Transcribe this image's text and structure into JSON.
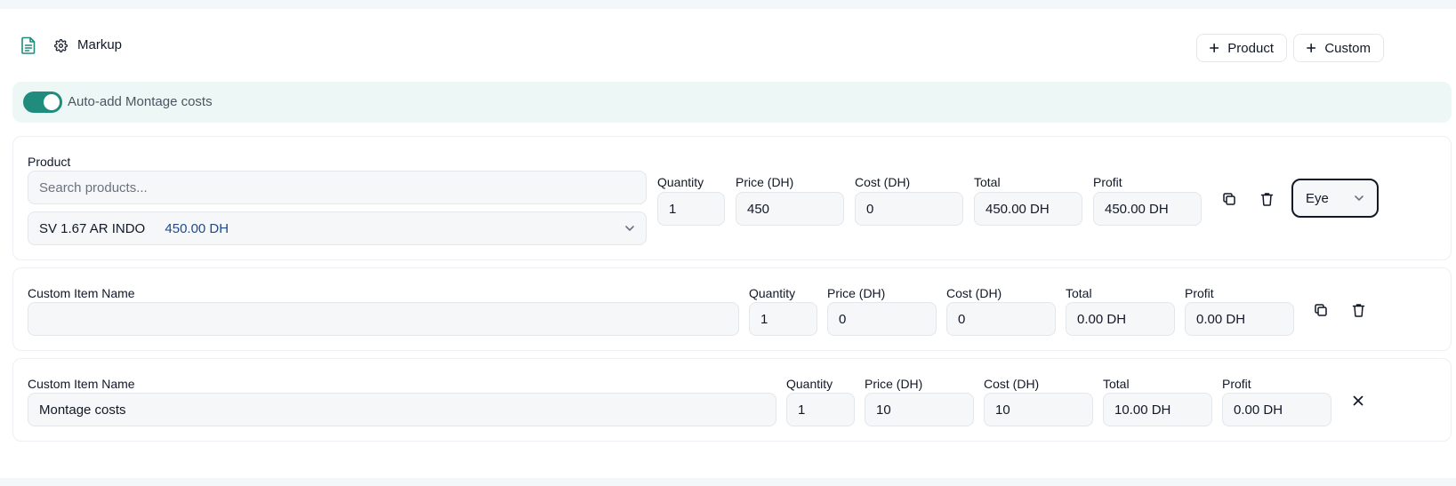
{
  "header": {
    "title": "Markup",
    "add_product_label": "Product",
    "add_custom_label": "Custom"
  },
  "toggle": {
    "label": "Auto-add Montage costs",
    "enabled": true
  },
  "colors": {
    "accent": "#1f8c7d",
    "toggle_bg": "#edf7f5",
    "price_link": "#1e4a8a"
  },
  "product_row": {
    "product_label": "Product",
    "search_placeholder": "Search products...",
    "selected_name": "SV 1.67 AR INDO",
    "selected_price": "450.00 DH",
    "quantity_label": "Quantity",
    "quantity": "1",
    "price_label": "Price (DH)",
    "price": "450",
    "cost_label": "Cost (DH)",
    "cost": "0",
    "total_label": "Total",
    "total": "450.00 DH",
    "profit_label": "Profit",
    "profit": "450.00 DH",
    "eye_select": "Eye"
  },
  "custom_rows": [
    {
      "name_label": "Custom Item Name",
      "name": "",
      "quantity_label": "Quantity",
      "quantity": "1",
      "price_label": "Price (DH)",
      "price": "0",
      "cost_label": "Cost (DH)",
      "cost": "0",
      "total_label": "Total",
      "total": "0.00 DH",
      "profit_label": "Profit",
      "profit": "0.00 DH"
    },
    {
      "name_label": "Custom Item Name",
      "name": "Montage costs",
      "quantity_label": "Quantity",
      "quantity": "1",
      "price_label": "Price (DH)",
      "price": "10",
      "cost_label": "Cost (DH)",
      "cost": "10",
      "total_label": "Total",
      "total": "10.00 DH",
      "profit_label": "Profit",
      "profit": "0.00 DH"
    }
  ]
}
